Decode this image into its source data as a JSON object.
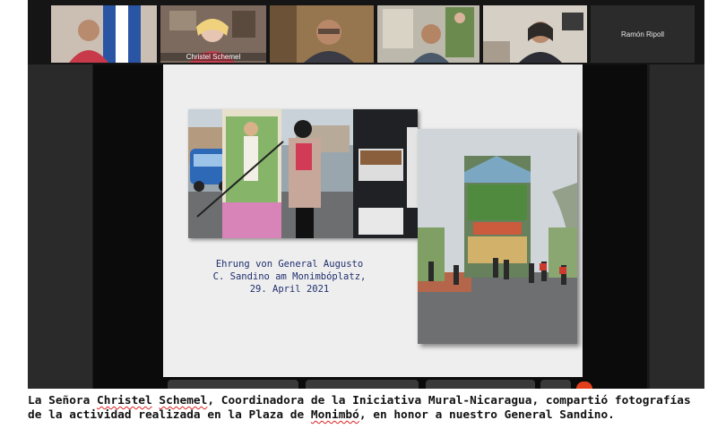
{
  "participants": [
    {
      "name": "",
      "shirt": "#c8394a",
      "bg": "#c9b8ad"
    },
    {
      "name": "Christel Schemel",
      "shirt": "#c04350",
      "bg": "#7f6d61",
      "active": true
    },
    {
      "name": "",
      "shirt": "#3b3b46",
      "bg": "#9a7a56"
    },
    {
      "name": "",
      "shirt": "#4a5a6a",
      "bg": "#b9b7a9"
    },
    {
      "name": "",
      "shirt": "#2d2d35",
      "bg": "#d3cdc2"
    },
    {
      "name": "Ramón Ripoll",
      "name_only": true
    }
  ],
  "slide": {
    "caption_lines": [
      "Ehrung von General Augusto",
      "C. Sandino am Monimbóplatz,",
      "29. April 2021"
    ]
  },
  "caption": {
    "p1": "La Señora ",
    "name_first": "Christel",
    "p2": " ",
    "name_last": "Schemel",
    "p3": ", Coordinadora de la Iniciativa Mural-Nicaragua, compartió fotografías de la actividad realizada en la Plaza de ",
    "place": "Monimbó",
    "p4": ", en honor a nuestro General Sandino."
  },
  "colors": {
    "active_border": "#19a6e6",
    "record": "#e2401c",
    "slide_text": "#1f2e6e"
  }
}
